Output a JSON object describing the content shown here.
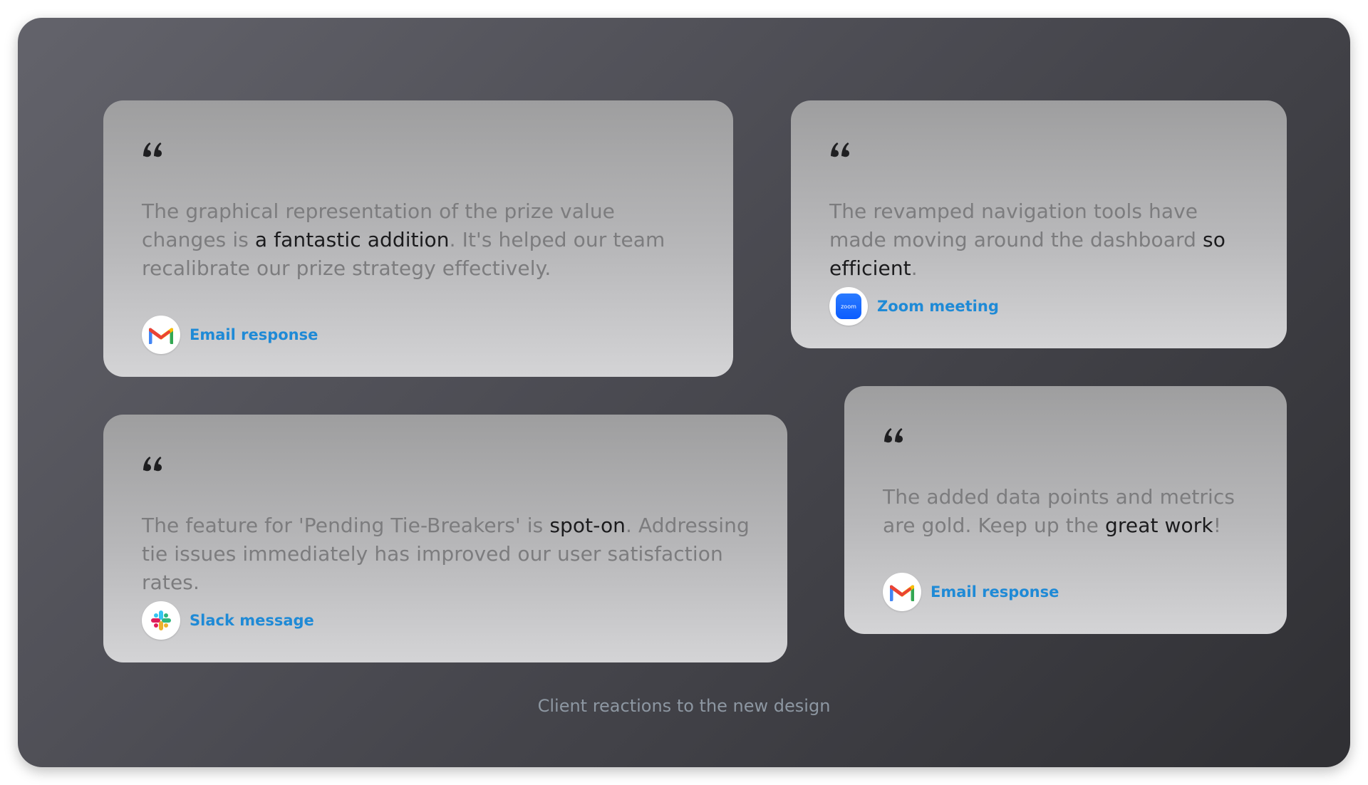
{
  "testimonials": [
    {
      "text_parts": [
        {
          "text": "The graphical representation of the prize value changes is ",
          "highlight": false
        },
        {
          "text": "a fantastic addition",
          "highlight": true
        },
        {
          "text": ". It's helped our team recalibrate our prize strategy effectively.",
          "highlight": false
        }
      ],
      "source": {
        "label": "Email response",
        "icon": "gmail-icon"
      }
    },
    {
      "text_parts": [
        {
          "text": "The revamped navigation tools have made moving around the dashboard ",
          "highlight": false
        },
        {
          "text": "so efficient",
          "highlight": true
        },
        {
          "text": ".",
          "highlight": false
        }
      ],
      "source": {
        "label": "Zoom meeting",
        "icon": "zoom-icon",
        "icon_text": "zoom"
      }
    },
    {
      "text_parts": [
        {
          "text": "The feature for 'Pending Tie-Breakers' is ",
          "highlight": false
        },
        {
          "text": "spot-on",
          "highlight": true
        },
        {
          "text": ". Addressing tie issues immediately has improved our user satisfaction rates.",
          "highlight": false
        }
      ],
      "source": {
        "label": "Slack message",
        "icon": "slack-icon"
      }
    },
    {
      "text_parts": [
        {
          "text": "The added data points and metrics are gold. Keep up the ",
          "highlight": false
        },
        {
          "text": "great work",
          "highlight": true
        },
        {
          "text": "!",
          "highlight": false
        }
      ],
      "source": {
        "label": "Email response",
        "icon": "gmail-icon"
      }
    }
  ],
  "caption": "Client reactions to the new design",
  "colors": {
    "accent_link": "#1f8ad6",
    "text_muted": "#7c7c7e",
    "text_highlight": "#1b1b1d",
    "caption": "#8d97a2"
  }
}
